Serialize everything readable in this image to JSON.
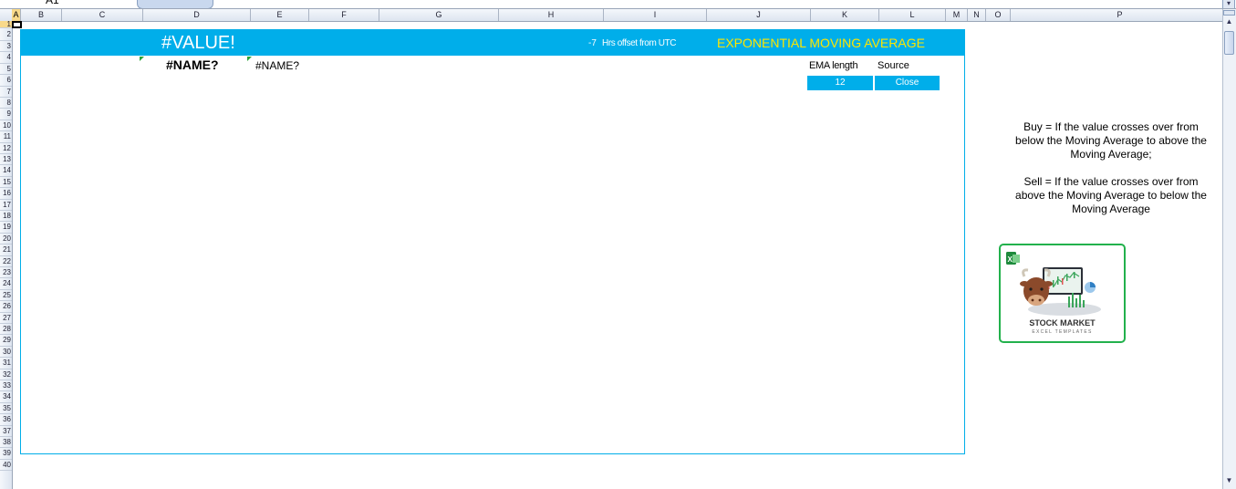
{
  "formula_bar": {
    "name_box": "A1"
  },
  "columns": [
    "A",
    "B",
    "C",
    "D",
    "E",
    "F",
    "G",
    "H",
    "I",
    "J",
    "K",
    "L",
    "M",
    "N",
    "O",
    "P"
  ],
  "rows": [
    "1",
    "2",
    "3",
    "4",
    "5",
    "6",
    "7",
    "8",
    "9",
    "10",
    "11",
    "12",
    "13",
    "14",
    "15",
    "16",
    "17",
    "18",
    "19",
    "20",
    "21",
    "22",
    "23",
    "24",
    "25",
    "26",
    "27",
    "28",
    "29",
    "30",
    "31",
    "32",
    "33",
    "34",
    "35",
    "36",
    "37",
    "38",
    "39",
    "40"
  ],
  "dashboard": {
    "header_value": "#VALUE!",
    "utc_offset": "-7",
    "utc_offset_label": "Hrs offset from UTC",
    "title": "EXPONENTIAL MOVING AVERAGE",
    "name_error_primary": "#NAME?",
    "name_error_secondary": "#NAME?",
    "ema_length_label": "EMA length",
    "source_label": "Source",
    "ema_length_value": "12",
    "source_value": "Close"
  },
  "notes": {
    "buy": "Buy = If the value crosses over from below the Moving Average to above the Moving Average;",
    "sell": "Sell = If the value crosses over from above the Moving Average to below the Moving Average"
  },
  "logo": {
    "title": "STOCK MARKET",
    "subtitle": "EXCEL TEMPLATES"
  },
  "colors": {
    "accent": "#00aeea",
    "title_text": "#ffe600",
    "logo_border": "#22b14c",
    "selection": "#f8d98a"
  }
}
